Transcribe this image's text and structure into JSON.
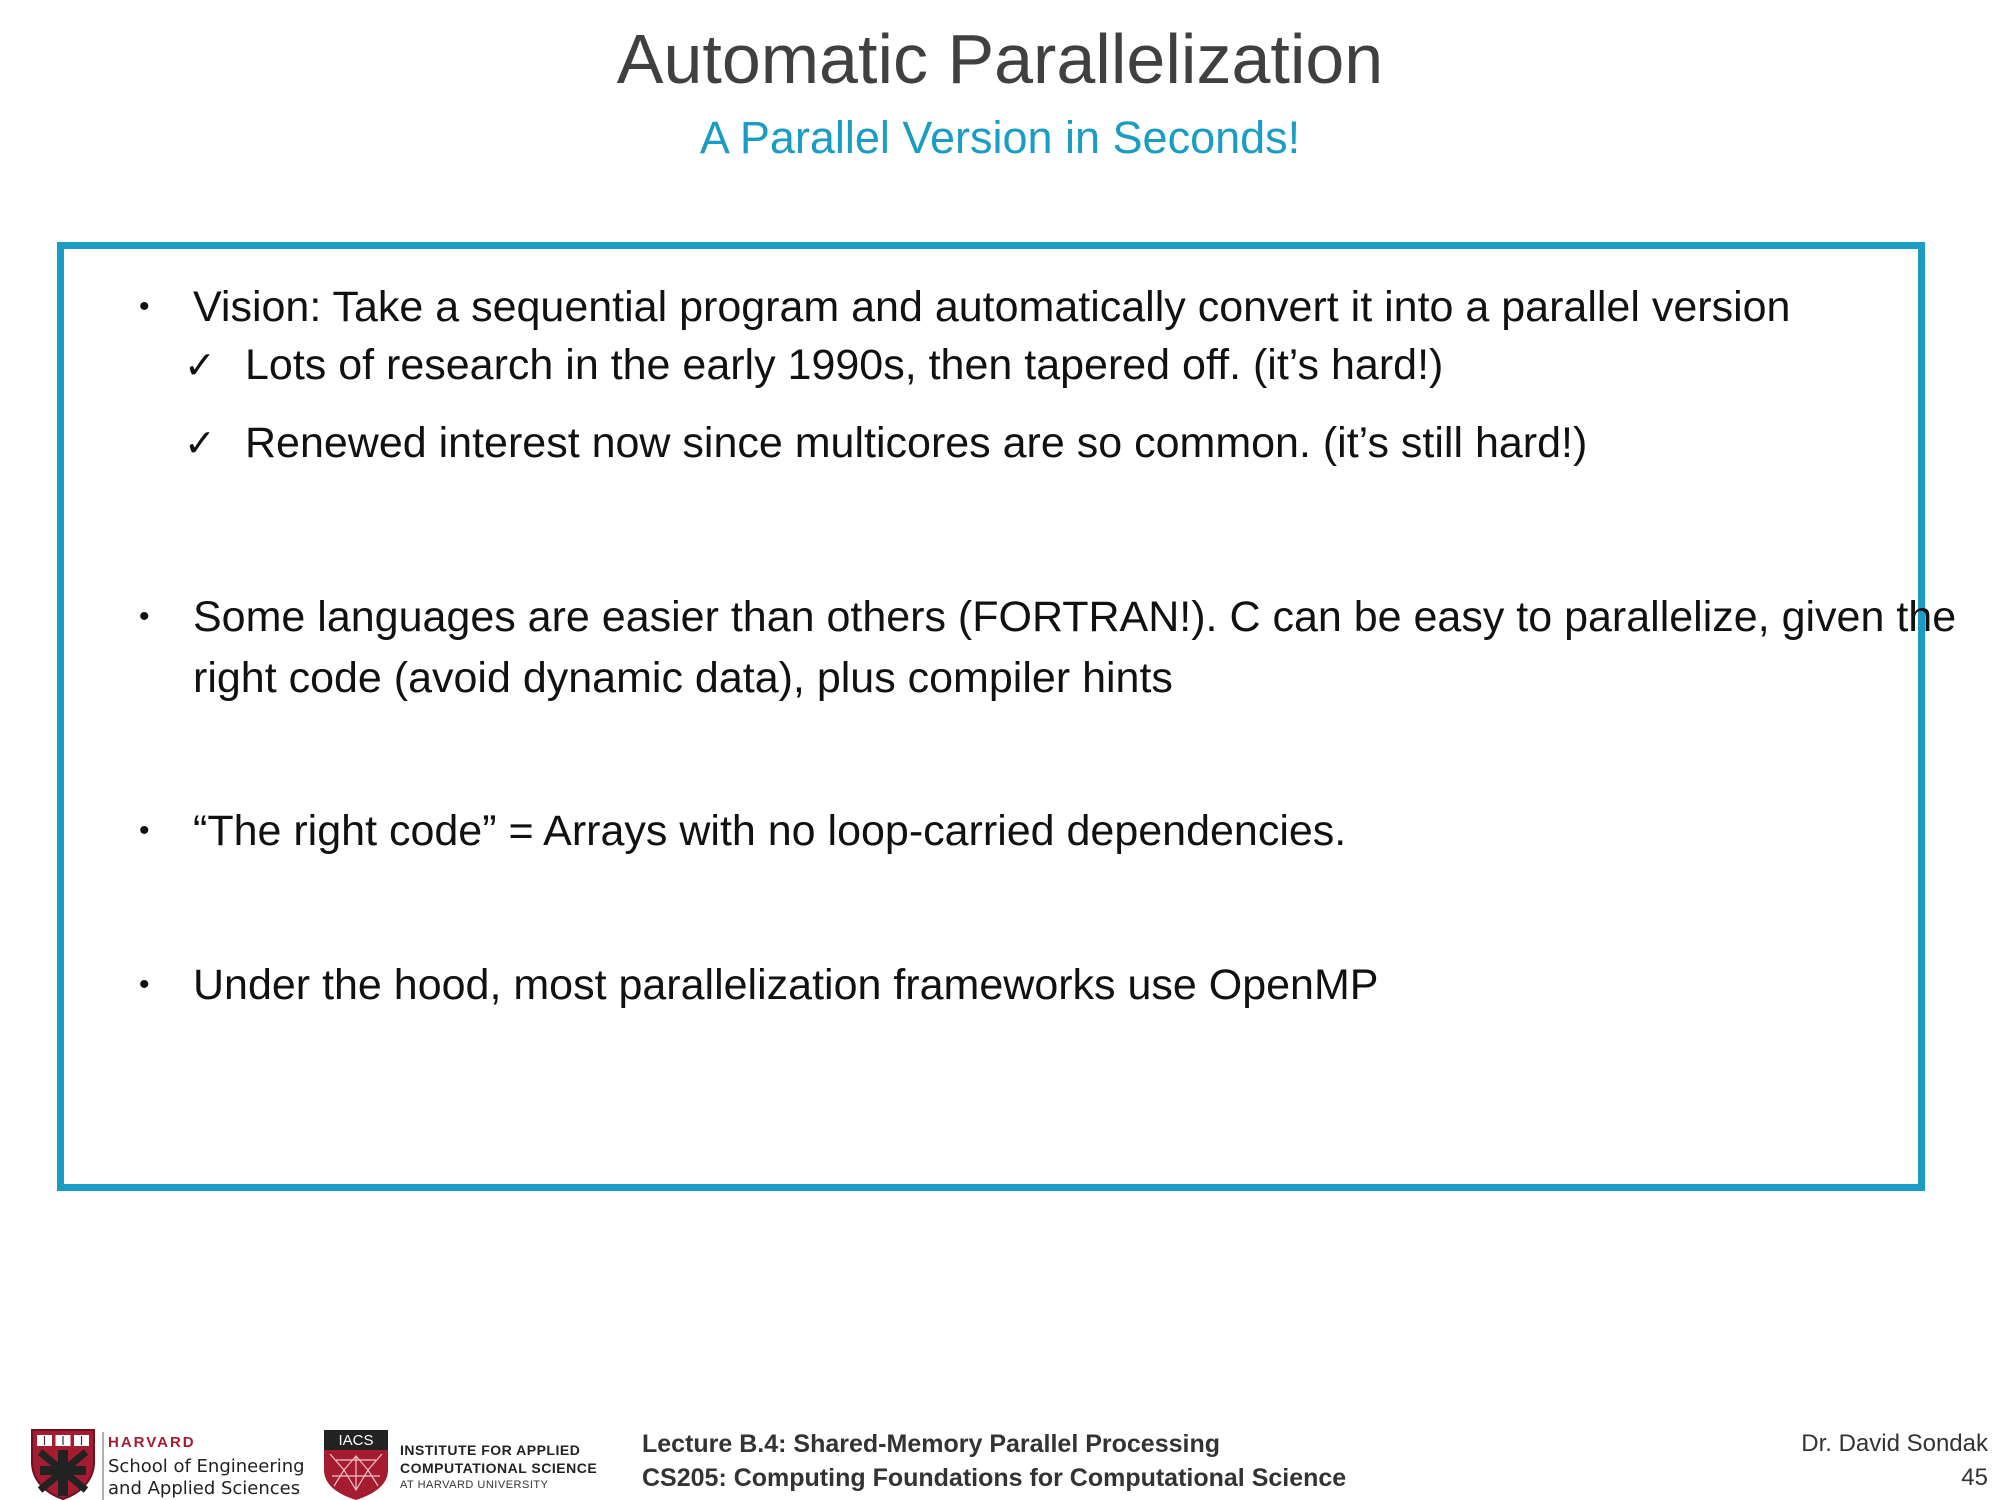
{
  "slide": {
    "title": "Automatic Parallelization",
    "subtitle": "A Parallel Version in Seconds!"
  },
  "content": {
    "bullet_marker": "•",
    "check_marker": "✓",
    "bullets": [
      {
        "text": "Vision: Take a sequential program and automatically convert it into a parallel version",
        "checks": [
          "Lots of research in the early 1990s, then tapered off. (it’s hard!)",
          "Renewed interest now since multicores are so common. (it’s still hard!)"
        ]
      },
      {
        "text": "Some languages are easier than others (FORTRAN!). C can be easy to parallelize, given the right code (avoid dynamic data), plus compiler hints"
      },
      {
        "text": "“The right code” = Arrays with no loop-carried dependencies."
      },
      {
        "text": "Under the hood, most parallelization frameworks use OpenMP"
      }
    ]
  },
  "footer": {
    "harvard_logo": {
      "name": "HARVARD",
      "school_line1": "School of Engineering",
      "school_line2": "and Applied Sciences",
      "icon": "harvard-shield-icon"
    },
    "iacs_logo": {
      "acronym": "IACS",
      "line1": "INSTITUTE FOR APPLIED",
      "line2": "COMPUTATIONAL SCIENCE",
      "line3": "AT HARVARD UNIVERSITY",
      "icon": "iacs-shield-icon"
    },
    "lecture": "Lecture B.4: Shared-Memory Parallel Processing",
    "course": "CS205: Computing Foundations for Computational Science",
    "author": "Dr. David Sondak",
    "page_number": "45"
  },
  "colors": {
    "accent": "#1a9cc4",
    "title": "#404040",
    "harvard_crimson": "#a51c30"
  }
}
